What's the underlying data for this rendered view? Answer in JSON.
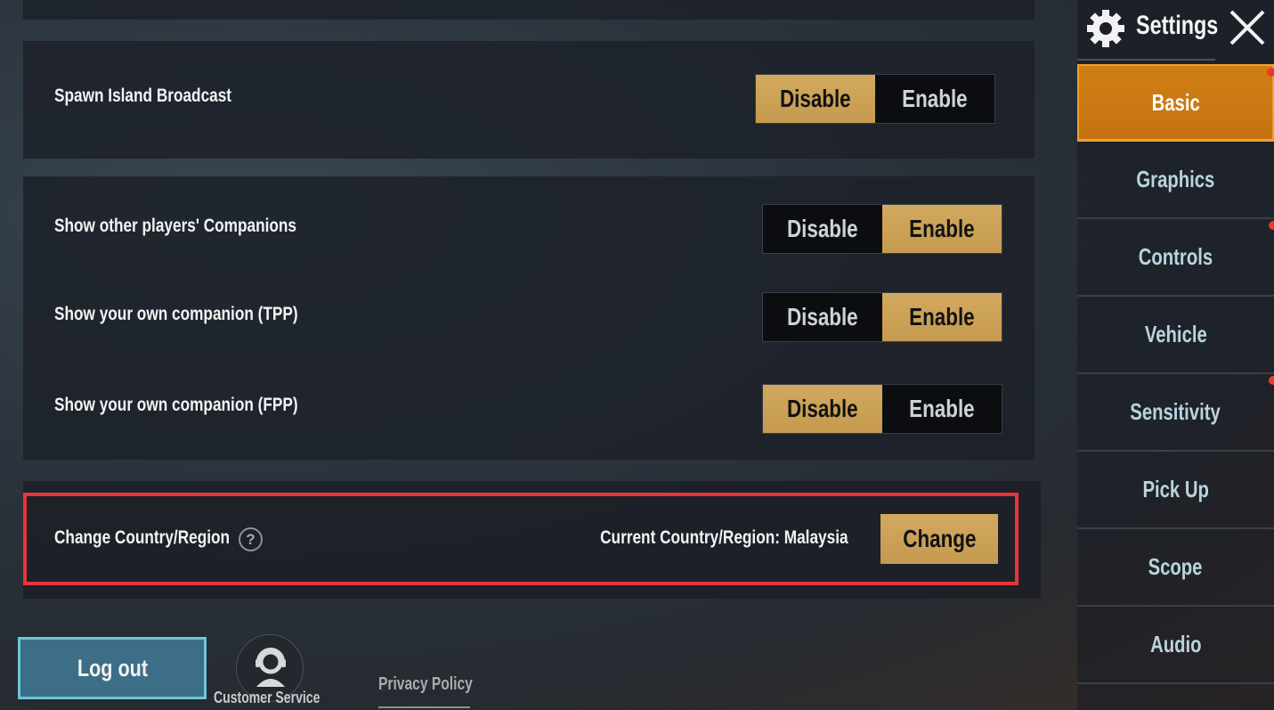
{
  "settings": {
    "spawn_island_broadcast": {
      "label": "Spawn Island Broadcast",
      "disable": "Disable",
      "enable": "Enable",
      "selected": "Disable"
    },
    "show_other_companions": {
      "label": "Show other players' Companions",
      "disable": "Disable",
      "enable": "Enable",
      "selected": "Enable"
    },
    "show_own_companion_tpp": {
      "label": "Show your own companion (TPP)",
      "disable": "Disable",
      "enable": "Enable",
      "selected": "Enable"
    },
    "show_own_companion_fpp": {
      "label": "Show your own companion (FPP)",
      "disable": "Disable",
      "enable": "Enable",
      "selected": "Disable"
    },
    "country_region": {
      "label": "Change Country/Region",
      "help_icon": "?",
      "current": "Current Country/Region: Malaysia",
      "change_button": "Change"
    }
  },
  "footer": {
    "logout": "Log out",
    "customer_service": "Customer Service",
    "privacy_policy": "Privacy Policy"
  },
  "sidebar": {
    "title": "Settings",
    "tabs": [
      {
        "label": "Basic",
        "active": true,
        "notification": true
      },
      {
        "label": "Graphics",
        "active": false,
        "notification": false
      },
      {
        "label": "Controls",
        "active": false,
        "notification": true
      },
      {
        "label": "Vehicle",
        "active": false,
        "notification": false
      },
      {
        "label": "Sensitivity",
        "active": false,
        "notification": true
      },
      {
        "label": "Pick Up",
        "active": false,
        "notification": false
      },
      {
        "label": "Scope",
        "active": false,
        "notification": false
      },
      {
        "label": "Audio",
        "active": false,
        "notification": false
      }
    ]
  },
  "colors": {
    "gold_selected": "#c9a055",
    "active_tab": "#cc7a12",
    "highlight_border": "#e8343a",
    "logout_bg": "#3c6e88",
    "notification_dot": "#ea3a28"
  }
}
